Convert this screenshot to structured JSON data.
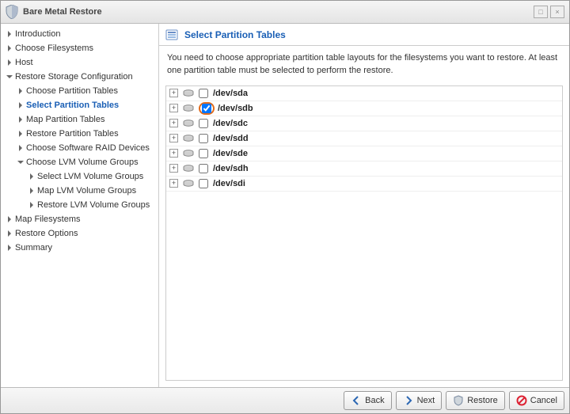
{
  "window": {
    "title": "Bare Metal Restore"
  },
  "sidebar": {
    "items": [
      {
        "label": "Introduction",
        "depth": 0,
        "expandable": true,
        "expanded": false
      },
      {
        "label": "Choose Filesystems",
        "depth": 0,
        "expandable": true,
        "expanded": false
      },
      {
        "label": "Host",
        "depth": 0,
        "expandable": true,
        "expanded": false
      },
      {
        "label": "Restore Storage Configuration",
        "depth": 0,
        "expandable": true,
        "expanded": true
      },
      {
        "label": "Choose Partition Tables",
        "depth": 1,
        "expandable": true,
        "expanded": false
      },
      {
        "label": "Select Partition Tables",
        "depth": 1,
        "expandable": true,
        "expanded": false,
        "current": true
      },
      {
        "label": "Map Partition Tables",
        "depth": 1,
        "expandable": true,
        "expanded": false
      },
      {
        "label": "Restore Partition Tables",
        "depth": 1,
        "expandable": true,
        "expanded": false
      },
      {
        "label": "Choose Software RAID Devices",
        "depth": 1,
        "expandable": true,
        "expanded": false
      },
      {
        "label": "Choose LVM Volume Groups",
        "depth": 1,
        "expandable": true,
        "expanded": true
      },
      {
        "label": "Select LVM Volume Groups",
        "depth": 2,
        "expandable": true,
        "expanded": false
      },
      {
        "label": "Map LVM Volume Groups",
        "depth": 2,
        "expandable": true,
        "expanded": false
      },
      {
        "label": "Restore LVM Volume Groups",
        "depth": 2,
        "expandable": true,
        "expanded": false
      },
      {
        "label": "Map Filesystems",
        "depth": 0,
        "expandable": true,
        "expanded": false
      },
      {
        "label": "Restore Options",
        "depth": 0,
        "expandable": true,
        "expanded": false
      },
      {
        "label": "Summary",
        "depth": 0,
        "expandable": true,
        "expanded": false
      }
    ]
  },
  "panel": {
    "title": "Select Partition Tables",
    "description": "You need to choose appropriate partition table layouts for the filesystems you want to restore. At least one partition table must be selected to perform the restore."
  },
  "devices": [
    {
      "name": "/dev/sda",
      "checked": false,
      "highlight": false
    },
    {
      "name": "/dev/sdb",
      "checked": true,
      "highlight": true
    },
    {
      "name": "/dev/sdc",
      "checked": false,
      "highlight": false
    },
    {
      "name": "/dev/sdd",
      "checked": false,
      "highlight": false
    },
    {
      "name": "/dev/sde",
      "checked": false,
      "highlight": false
    },
    {
      "name": "/dev/sdh",
      "checked": false,
      "highlight": false
    },
    {
      "name": "/dev/sdi",
      "checked": false,
      "highlight": false
    }
  ],
  "buttons": {
    "back": "Back",
    "next": "Next",
    "restore": "Restore",
    "cancel": "Cancel"
  }
}
